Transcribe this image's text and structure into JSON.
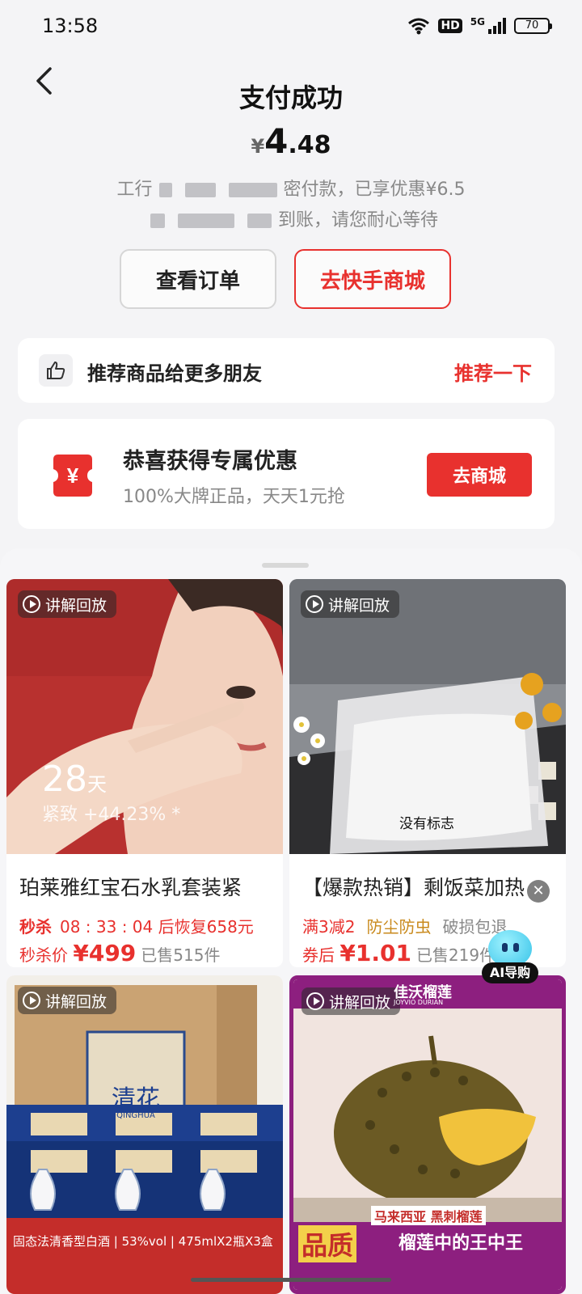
{
  "status_bar": {
    "time": "13:58",
    "network": "5G",
    "hd": "HD",
    "battery": "70"
  },
  "header": {
    "title": "支付成功"
  },
  "payment": {
    "currency": "¥",
    "amount_int": "4",
    "amount_dec": ".48",
    "line1_prefix": "工行",
    "line1_suffix": "密付款，已享优惠¥6.5",
    "line2_suffix": "到账，请您耐心等待"
  },
  "actions": {
    "view_order": "查看订单",
    "go_mall": "去快手商城"
  },
  "recommend": {
    "text": "推荐商品给更多朋友",
    "action": "推荐一下"
  },
  "coupon": {
    "title": "恭喜获得专属优惠",
    "subtitle": "100%大牌正品，天天1元抢",
    "button": "去商城"
  },
  "products": [
    {
      "badge": "讲解回放",
      "title": "珀莱雅红宝石水乳套装紧",
      "overlay_days": "28",
      "overlay_unit": "天",
      "overlay_text": "紧致 +44.23% *",
      "seckill_label": "秒杀",
      "countdown": "08 : 33 : 04",
      "restore_text": "后恢复658元",
      "price_label": "秒杀价",
      "currency": "¥",
      "price": "499",
      "sold": "已售515件"
    },
    {
      "badge": "讲解回放",
      "title": "【爆款热销】剩饭菜加热",
      "overlay_text": "没有标志",
      "tags": [
        "满3减2",
        "防尘防虫",
        "破损包退"
      ],
      "price_label": "券后",
      "currency": "¥",
      "price": "1.01",
      "sold": "已售219件"
    },
    {
      "badge": "讲解回放",
      "brand": "清花",
      "brand_en": "QINGHUA",
      "bottom_text": "固态法清香型白酒 | 53%vol | 475mlX2瓶X3盒"
    },
    {
      "badge": "讲解回放",
      "brand": "佳沃榴莲",
      "brand_en": "JOYVIO DURIAN",
      "tag1": "马来西亚 黑刺榴莲",
      "bottom_left": "品质",
      "bottom_right": "榴莲中的王中王"
    }
  ],
  "ai_assistant": {
    "label": "AI导购"
  },
  "close_symbol": "✕",
  "colors": {
    "accent": "#e8312e",
    "background": "#f4f4f6"
  }
}
